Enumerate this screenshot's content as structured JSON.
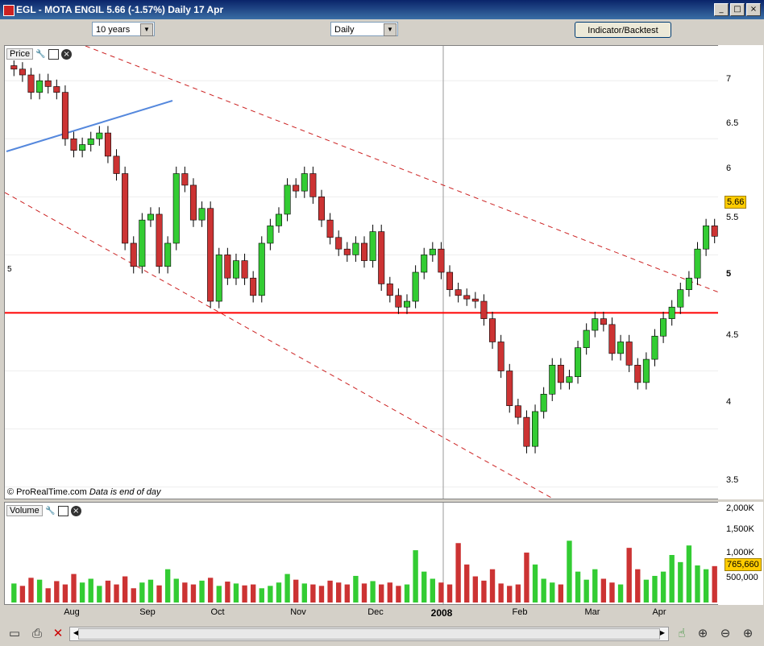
{
  "window": {
    "title": "EGL - MOTA ENGIL    5.66 (-1.57%)    Daily  17 Apr",
    "min": "_",
    "max": "□",
    "close": "×"
  },
  "toolbar": {
    "range_value": "10 years",
    "period_value": "Daily",
    "indicator_button": "Indicator/Backtest"
  },
  "price_panel": {
    "label": "Price",
    "watermark": "© ProRealTime.com",
    "watermark_note": "Data is end of day",
    "hline_label": "5",
    "hline_axis": "5",
    "current_price": "5.66"
  },
  "volume_panel": {
    "label": "Volume",
    "current_volume": "765,660"
  },
  "price_axis_ticks": [
    "7",
    "6.5",
    "6",
    "5.5",
    "4.5",
    "4",
    "3.5"
  ],
  "volume_axis_ticks": [
    "2,000K",
    "1,500K",
    "1,000K",
    "500,000"
  ],
  "time_axis": [
    "Aug",
    "Sep",
    "Oct",
    "Nov",
    "Dec",
    "2008",
    "Feb",
    "Mar",
    "Apr"
  ],
  "icons": {
    "print": "print-icon",
    "tools": "wrench-icon",
    "window": "window-icon",
    "close": "close-icon",
    "zoom_fit": "zoom-fit-icon",
    "zoom_out": "zoom-out-icon",
    "zoom_in": "zoom-in-icon"
  },
  "colors": {
    "up": "#33cc33",
    "down": "#cc3333",
    "support": "#ff0000",
    "trend": "#5588dd",
    "channel": "#cc2222"
  },
  "chart_data": {
    "type": "candlestick",
    "title": "EGL - MOTA ENGIL",
    "period": "Daily",
    "last_close": 5.66,
    "change_pct": -1.57,
    "last_volume": 765660,
    "support_level": 5,
    "ylim": [
      3.4,
      7.3
    ],
    "closes": [
      7.1,
      7.05,
      6.9,
      7.0,
      6.95,
      6.9,
      6.5,
      6.4,
      6.45,
      6.5,
      6.55,
      6.35,
      6.2,
      5.6,
      5.4,
      5.8,
      5.85,
      5.4,
      5.6,
      6.2,
      6.1,
      5.8,
      5.9,
      5.1,
      5.5,
      5.3,
      5.45,
      5.3,
      5.15,
      5.6,
      5.75,
      5.85,
      6.1,
      6.05,
      6.2,
      6.0,
      5.8,
      5.65,
      5.55,
      5.5,
      5.6,
      5.45,
      5.7,
      5.25,
      5.15,
      5.05,
      5.1,
      5.35,
      5.5,
      5.55,
      5.35,
      5.2,
      5.15,
      5.12,
      5.1,
      4.95,
      4.75,
      4.5,
      4.2,
      4.1,
      3.85,
      4.15,
      4.3,
      4.55,
      4.4,
      4.45,
      4.7,
      4.85,
      4.95,
      4.9,
      4.65,
      4.75,
      4.55,
      4.4,
      4.6,
      4.8,
      4.95,
      5.05,
      5.2,
      5.3,
      5.55,
      5.75,
      5.66
    ],
    "volumes": [
      400,
      350,
      520,
      480,
      300,
      450,
      380,
      600,
      420,
      500,
      350,
      460,
      380,
      550,
      300,
      420,
      480,
      360,
      700,
      500,
      420,
      380,
      460,
      520,
      350,
      440,
      400,
      360,
      380,
      300,
      350,
      420,
      600,
      480,
      400,
      380,
      350,
      460,
      420,
      380,
      560,
      400,
      450,
      380,
      420,
      350,
      380,
      1100,
      650,
      500,
      420,
      380,
      1250,
      800,
      550,
      460,
      700,
      400,
      350,
      380,
      1050,
      800,
      500,
      420,
      380,
      1300,
      650,
      480,
      700,
      500,
      420,
      380,
      1150,
      700,
      480,
      560,
      650,
      1000,
      850,
      1200,
      780,
      700,
      765.66
    ]
  }
}
